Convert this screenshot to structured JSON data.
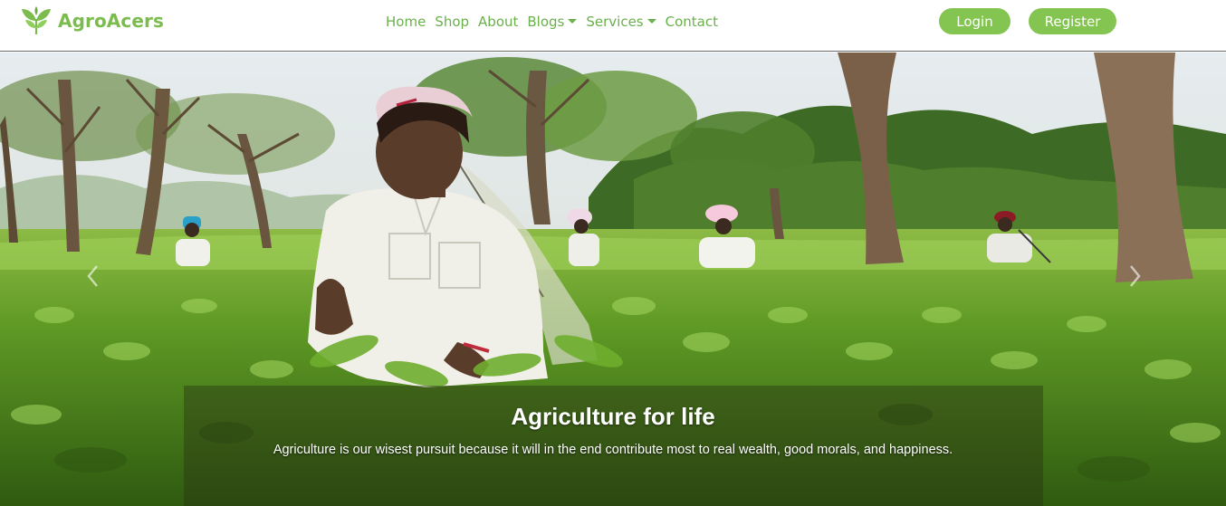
{
  "brand": {
    "name": "AgroAcers",
    "logo_icon": "leaf-sprout-icon",
    "color": "#7cbc4e"
  },
  "nav": {
    "links": [
      {
        "label": "Home",
        "dropdown": false
      },
      {
        "label": "Shop",
        "dropdown": false
      },
      {
        "label": "About",
        "dropdown": false
      },
      {
        "label": "Blogs",
        "dropdown": true
      },
      {
        "label": "Services",
        "dropdown": true
      },
      {
        "label": "Contact",
        "dropdown": false
      }
    ],
    "link_color": "#6ab04c"
  },
  "auth": {
    "login_label": "Login",
    "register_label": "Register",
    "button_color": "#84c451"
  },
  "hero": {
    "image_subject": "tea-plantation-workers",
    "caption": {
      "title": "Agriculture for life",
      "text": "Agriculture is our wisest pursuit because it will in the end contribute most to real wealth, good morals, and happiness."
    },
    "prev_icon": "chevron-left-icon",
    "next_icon": "chevron-right-icon"
  }
}
